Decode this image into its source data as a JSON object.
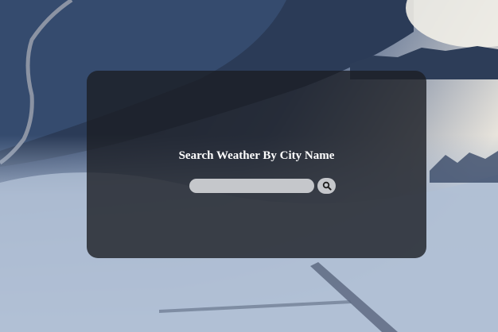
{
  "heading": "Search Weather By City Name",
  "search": {
    "value": "",
    "placeholder": "",
    "button_icon": "search-icon"
  },
  "colors": {
    "card_background": "rgba(28,30,36,0.80)",
    "input_background": "#c5c7cb",
    "heading_text": "#ffffff"
  }
}
